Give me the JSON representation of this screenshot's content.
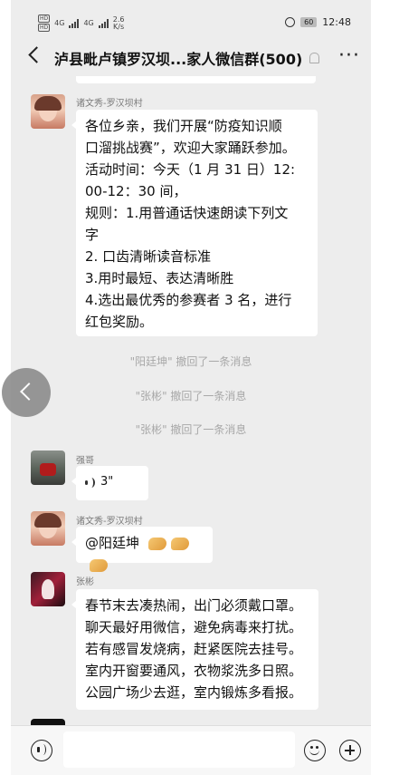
{
  "status_bar": {
    "net1": "HD",
    "net2": "HD",
    "sig1": "4G",
    "sig2": "4G",
    "speed_value": "2.6",
    "speed_unit": "K/s",
    "battery": "60",
    "time": "12:48"
  },
  "header": {
    "title": "泸县毗卢镇罗汉坝...家人微信群(500)",
    "more_label": "···"
  },
  "messages": [
    {
      "sender": "诸文秀-罗汉坝村",
      "avatar": "girl-avatar",
      "lines": [
        "各位乡亲，我们开展“防疫知识顺",
        "口溜挑战赛”，欢迎大家踊跃参加。",
        "活动时间：今天（1 月 31 日）12:",
        "00-12：30 间，",
        "规则：1.用普通话快速朗读下列文",
        "字",
        "2. 口齿清晰读音标准",
        "3.用时最短、表达清晰胜",
        "4.选出最优秀的参赛者 3 名，进行",
        "红包奖励。"
      ]
    },
    {
      "sender": "强哥",
      "avatar": "motorbike-avatar",
      "voice_duration": "3\""
    },
    {
      "sender": "诸文秀-罗汉坝村",
      "avatar": "girl-avatar",
      "text": "@阳廷坤",
      "emoji": [
        "clap-emoji",
        "clap-emoji",
        "clap-emoji"
      ]
    },
    {
      "sender": "张彬",
      "avatar": "performer-avatar",
      "lines": [
        "春节末去凑热闹，出门必须戴口罩。",
        "聊天最好用微信，避免病毒来打扰。",
        "若有感冒发烧病，赶紧医院去挂号。",
        "室内开窗要通风，衣物浆洗多日照。",
        "公园广场少去逛，室内锻炼多看报。"
      ]
    }
  ],
  "system_notices": [
    "\"阳廷坤\" 撤回了一条消息",
    "\"张彬\" 撤回了一条消息",
    "\"张彬\" 撤回了一条消息"
  ],
  "input": {
    "value": ""
  }
}
